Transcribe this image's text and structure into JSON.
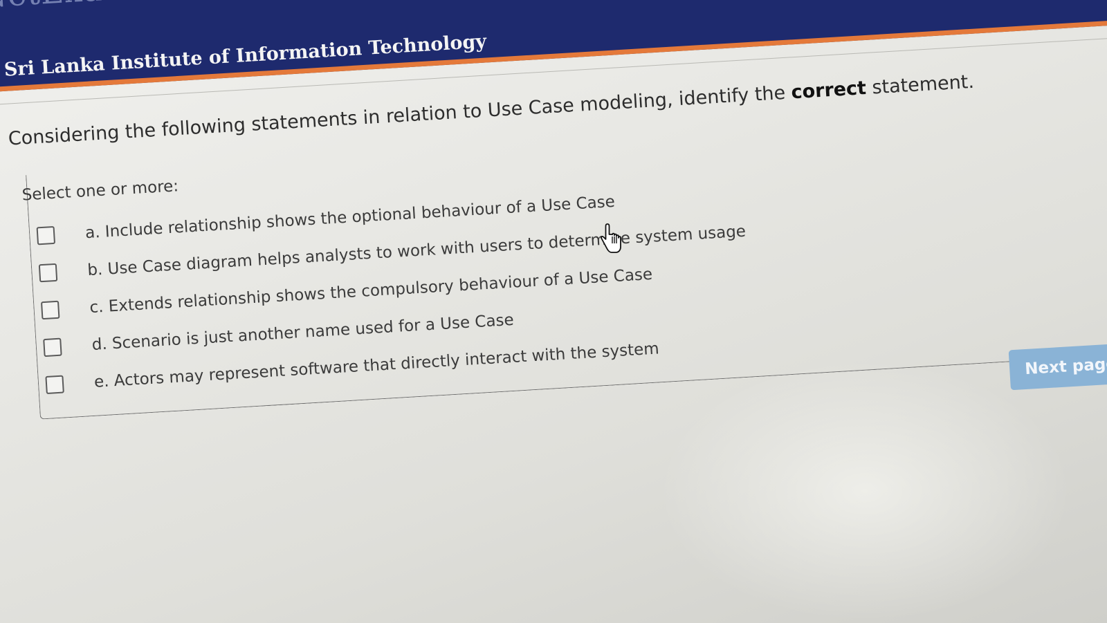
{
  "header": {
    "brand_mark": "NetExam",
    "institute": "Sri Lanka Institute of Information Technology"
  },
  "question": {
    "text_before": "Considering the following statements in relation to Use Case modeling, identify the ",
    "text_emphasis": "correct",
    "text_after": " statement.",
    "prompt": "Select one or more:",
    "options": [
      {
        "label": "a. Include  relationship shows the optional behaviour of a Use Case",
        "checked": false
      },
      {
        "label": "b. Use Case diagram helps analysts to work with users to determine system usage",
        "checked": false
      },
      {
        "label": "c. Extends relationship shows the compulsory behaviour of a Use Case",
        "checked": false
      },
      {
        "label": "d. Scenario is just another name used for a Use Case",
        "checked": false
      },
      {
        "label": "e. Actors may represent software that directly interact with the system",
        "checked": false
      }
    ]
  },
  "navigation": {
    "next_label": "Next page"
  },
  "colors": {
    "banner": "#1e2a6e",
    "banner_stripe": "#e4793a",
    "button": "#8ab3d6"
  },
  "icons": {
    "cursor": "hand-pointer-icon"
  }
}
